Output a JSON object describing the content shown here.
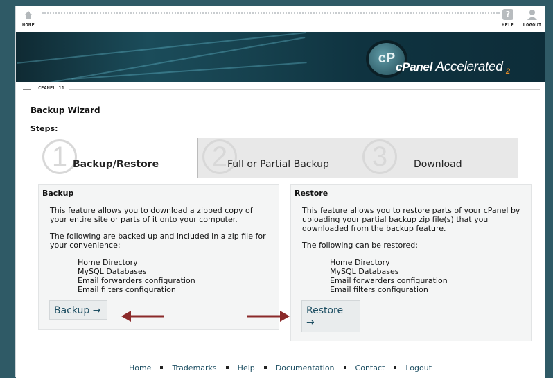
{
  "topnav": {
    "home_label": "HOME",
    "help_label": "HELP",
    "logout_label": "LOGOUT",
    "home_icon": "home-icon",
    "help_icon": "question-mark-icon",
    "logout_icon": "user-icon"
  },
  "banner": {
    "logo_brand": "cPanel",
    "logo_word": "Accelerated",
    "logo_version": "2",
    "logo_glyph": "cP"
  },
  "version_label": "CPANEL 11",
  "page": {
    "title": "Backup Wizard",
    "steps_label": "Steps:"
  },
  "steps": [
    {
      "num": "1",
      "label": "Backup/Restore",
      "active": true
    },
    {
      "num": "2",
      "label": "Full or Partial Backup",
      "active": false
    },
    {
      "num": "3",
      "label": "Download",
      "active": false
    }
  ],
  "backup": {
    "heading": "Backup",
    "description": "This feature allows you to download a zipped copy of your entire site or parts of it onto your computer.",
    "included_text": "The following are backed up and included in a zip file for your convenience:",
    "items": [
      "Home Directory",
      "MySQL Databases",
      "Email forwarders configuration",
      "Email filters configuration"
    ],
    "button": "Backup →"
  },
  "restore": {
    "heading": "Restore",
    "description": "This feature allows you to restore parts of your cPanel by uploading your partial backup zip file(s) that you downloaded from the backup feature.",
    "restorable_text": "The following can be restored:",
    "items": [
      "Home Directory",
      "MySQL Databases",
      "Email forwarders configuration",
      "Email filters configuration"
    ],
    "button_line1": "Restore",
    "button_line2": "→"
  },
  "footer": {
    "links": [
      "Home",
      "Trademarks",
      "Help",
      "Documentation",
      "Contact",
      "Logout"
    ]
  },
  "colors": {
    "link": "#1e4f63",
    "annotation_arrow": "#8b2a2a",
    "banner": "#16414e"
  }
}
